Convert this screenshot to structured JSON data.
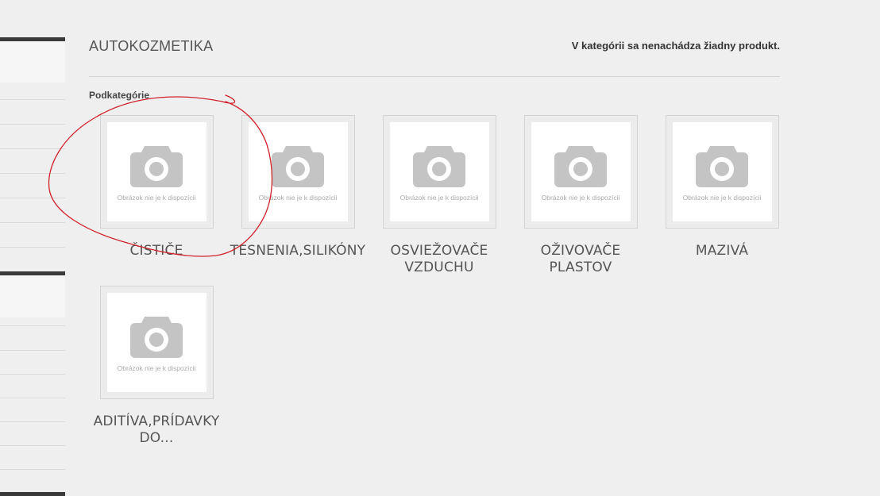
{
  "header": {
    "title": "AUTOKOZMETIKA",
    "notice": "V kategórii sa nenachádza žiadny produkt."
  },
  "subcategories": {
    "label": "Podkategórie",
    "placeholder_text": "Obrázok nie je k dispozícii",
    "items": [
      {
        "name": "ČISTIČE"
      },
      {
        "name": "TESNENIA,SILIKÓNY"
      },
      {
        "name": "OSVIEŽOVAČE VZDUCHU"
      },
      {
        "name": "OŽIVOVAČE PLASTOV"
      },
      {
        "name": "MAZIVÁ"
      },
      {
        "name": "ADITÍVA,PRÍDAVKY DO..."
      }
    ]
  },
  "colors": {
    "background": "#efefef",
    "annotation_stroke": "#d0202a",
    "camera_icon": "#c4c4c4"
  }
}
